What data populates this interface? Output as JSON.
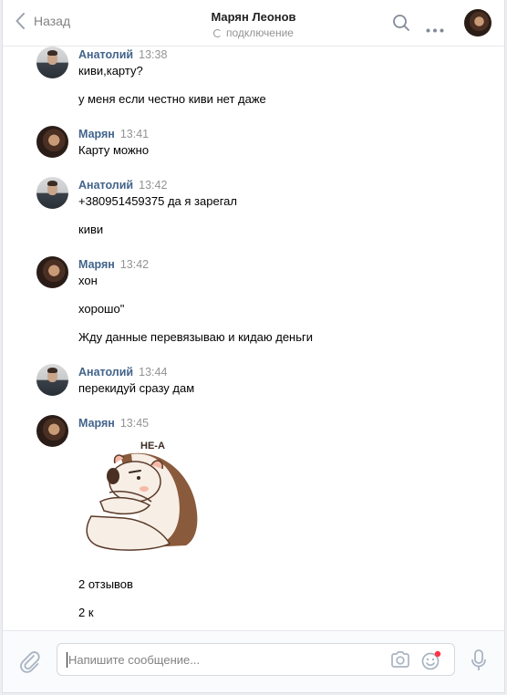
{
  "header": {
    "back_label": "Назад",
    "title": "Марян Леонов",
    "status": "подключение"
  },
  "messages": [
    {
      "author": "Анатолий",
      "time": "13:38",
      "lines": [
        "киви,карту?",
        "у меня если честно киви нет даже"
      ]
    },
    {
      "author": "Марян",
      "time": "13:41",
      "lines": [
        "Карту можно"
      ]
    },
    {
      "author": "Анатолий",
      "time": "13:42",
      "lines": [
        "+380951459375 да я зарегал",
        "киви"
      ]
    },
    {
      "author": "Марян",
      "time": "13:42",
      "lines": [
        "хон",
        "хорошо\"",
        "Жду данные перевязываю и кидаю деньги"
      ]
    },
    {
      "author": "Анатолий",
      "time": "13:44",
      "lines": [
        "перекидуй сразу дам"
      ]
    },
    {
      "author": "Марян",
      "time": "13:45",
      "sticker_text": "НЕ-А",
      "lines": [
        "2 отзывов",
        "2 к"
      ]
    }
  ],
  "input": {
    "placeholder": "Напишите сообщение..."
  },
  "colors": {
    "author": "#42648b",
    "time": "#939393",
    "accent_dot": "#ff3347"
  },
  "icons": {
    "back": "chevron-left-icon",
    "search": "search-icon",
    "more": "more-dots-icon",
    "attach": "paperclip-icon",
    "camera": "camera-icon",
    "smile": "smile-icon",
    "mic": "microphone-icon"
  }
}
